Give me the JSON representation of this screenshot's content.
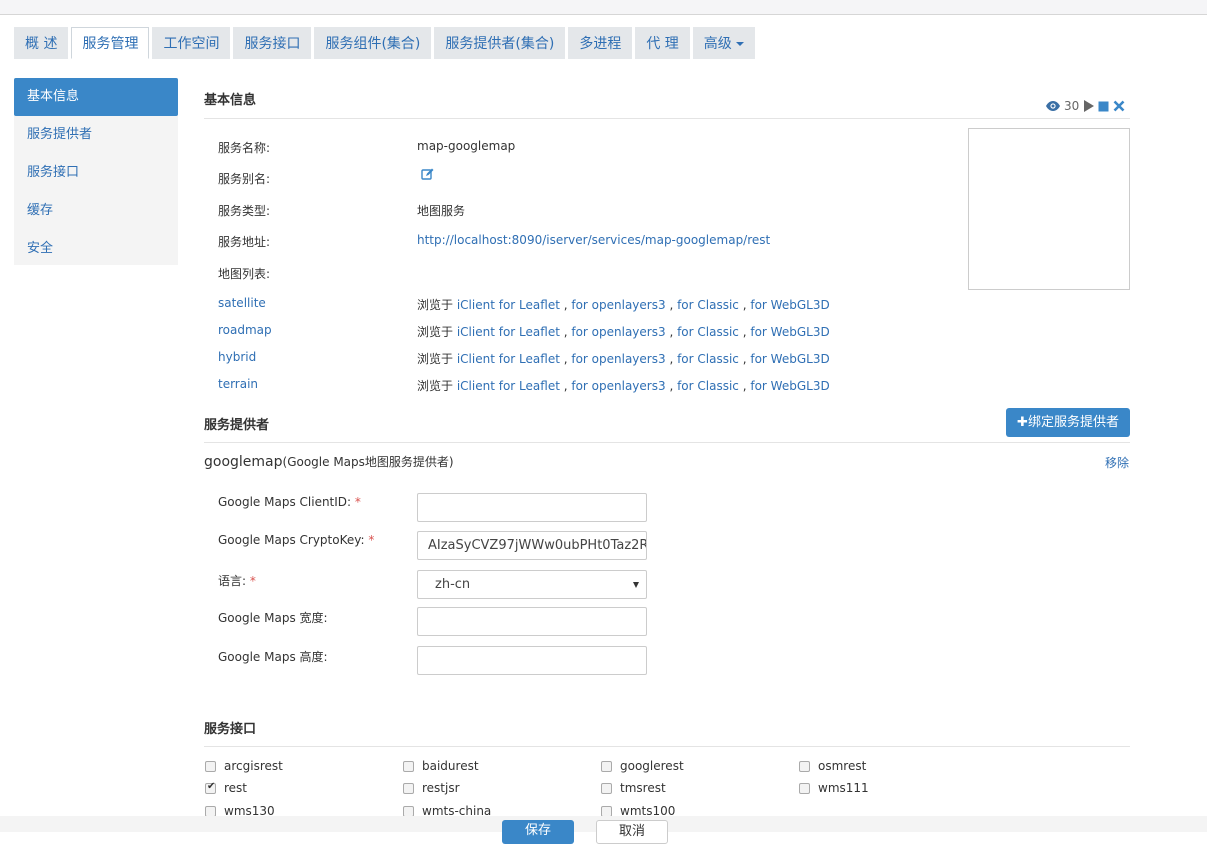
{
  "tabs": [
    {
      "label": "概 述"
    },
    {
      "label": "服务管理"
    },
    {
      "label": "工作空间"
    },
    {
      "label": "服务接口"
    },
    {
      "label": "服务组件(集合)"
    },
    {
      "label": "服务提供者(集合)"
    },
    {
      "label": "多进程"
    },
    {
      "label": "代 理"
    },
    {
      "label": "高级"
    }
  ],
  "sidebar": {
    "items": [
      {
        "label": "基本信息"
      },
      {
        "label": "服务提供者"
      },
      {
        "label": "服务接口"
      },
      {
        "label": "缓存"
      },
      {
        "label": "安全"
      }
    ]
  },
  "basic": {
    "title": "基本信息",
    "view_count": "30",
    "rows": [
      {
        "label": "服务名称:",
        "value": "map-googlemap"
      },
      {
        "label": "服务别名:",
        "value": ""
      },
      {
        "label": "服务类型:",
        "value": "地图服务"
      },
      {
        "label": "服务地址:",
        "value": "http://localhost:8090/iserver/services/map-googlemap/rest"
      },
      {
        "label": "地图列表:",
        "value": ""
      }
    ],
    "browse_prefix": "浏览于",
    "browse_links": [
      "iClient for Leaflet",
      "for openlayers3",
      "for Classic",
      "for WebGL3D"
    ],
    "maps": [
      "satellite",
      "roadmap",
      "hybrid",
      "terrain"
    ]
  },
  "providers": {
    "title": "服务提供者",
    "bind_button": "绑定服务提供者",
    "name": "googlemap",
    "desc": "(Google Maps地图服务提供者)",
    "remove": "移除",
    "fields": [
      {
        "label": "Google Maps ClientID:",
        "required": true,
        "value": ""
      },
      {
        "label": "Google Maps CryptoKey:",
        "required": true,
        "value": "AIzaSyCVZ97jWWw0ubPHt0Taz2R"
      },
      {
        "label": "语言:",
        "required": true,
        "value": "zh-cn"
      },
      {
        "label": "Google Maps 宽度:",
        "required": false,
        "value": ""
      },
      {
        "label": "Google Maps 高度:",
        "required": false,
        "value": ""
      }
    ]
  },
  "interfaces": {
    "title": "服务接口",
    "items": [
      {
        "name": "arcgisrest",
        "checked": false
      },
      {
        "name": "baidurest",
        "checked": false
      },
      {
        "name": "googlerest",
        "checked": false
      },
      {
        "name": "osmrest",
        "checked": false
      },
      {
        "name": "rest",
        "checked": true
      },
      {
        "name": "restjsr",
        "checked": false
      },
      {
        "name": "tmsrest",
        "checked": false
      },
      {
        "name": "wms111",
        "checked": false
      },
      {
        "name": "wms130",
        "checked": false
      },
      {
        "name": "wmts-china",
        "checked": false
      },
      {
        "name": "wmts100",
        "checked": false
      }
    ]
  },
  "footer": {
    "save": "保存",
    "cancel": "取消"
  },
  "colors": {
    "accent": "#3a87c8",
    "link": "#2f6fb4",
    "required": "#d9534f"
  }
}
